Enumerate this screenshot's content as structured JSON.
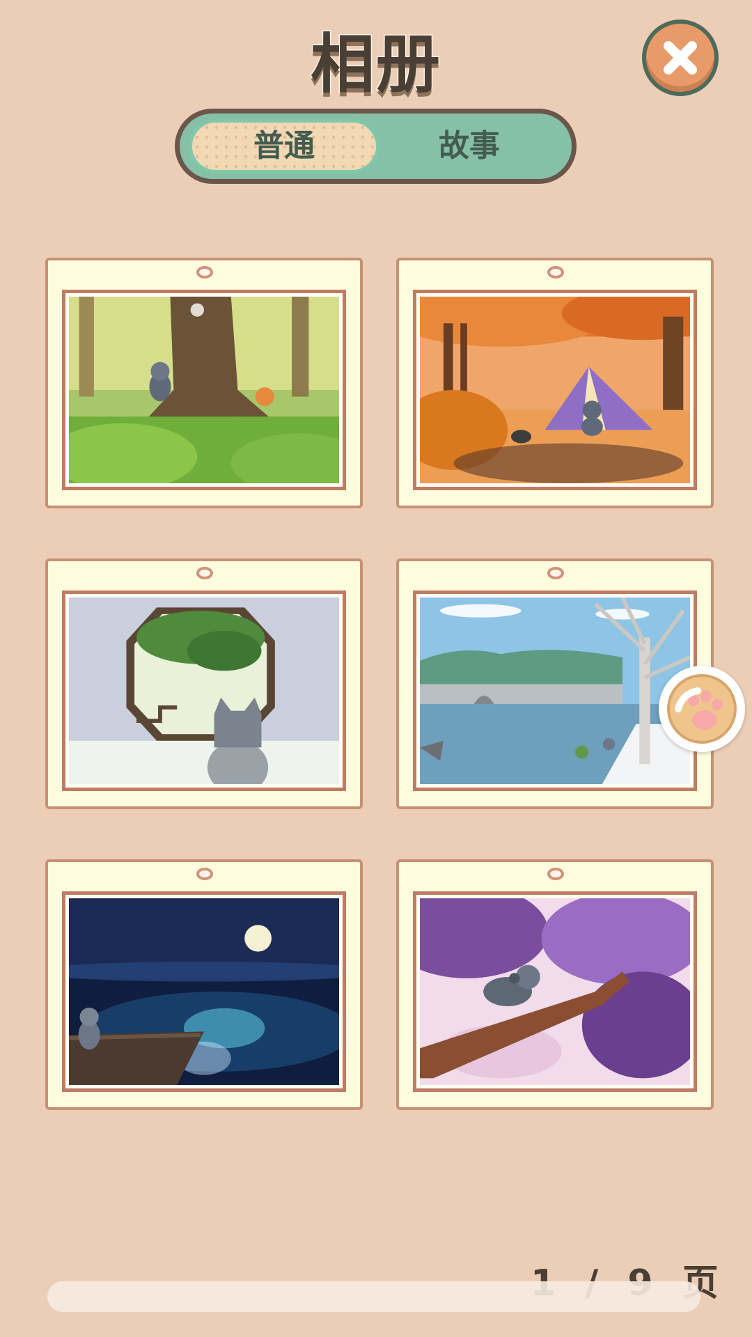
{
  "header": {
    "title": "相册"
  },
  "tabs": [
    {
      "label": "普通",
      "active": true
    },
    {
      "label": "故事",
      "active": false
    }
  ],
  "photos": [
    {
      "scene": "forest-tree-cat"
    },
    {
      "scene": "autumn-tent-cat"
    },
    {
      "scene": "window-cat"
    },
    {
      "scene": "bridge-lake-cat"
    },
    {
      "scene": "night-sea-cat"
    },
    {
      "scene": "purple-tree-cat"
    }
  ],
  "pagination": {
    "current": "1",
    "separator": "/",
    "total": "9",
    "unit": "页"
  },
  "icons": {
    "close": "close-icon",
    "paw": "paw-icon"
  },
  "colors": {
    "background": "#ecceb7",
    "tab_green": "#86c0a6",
    "close_orange": "#e89b68"
  }
}
